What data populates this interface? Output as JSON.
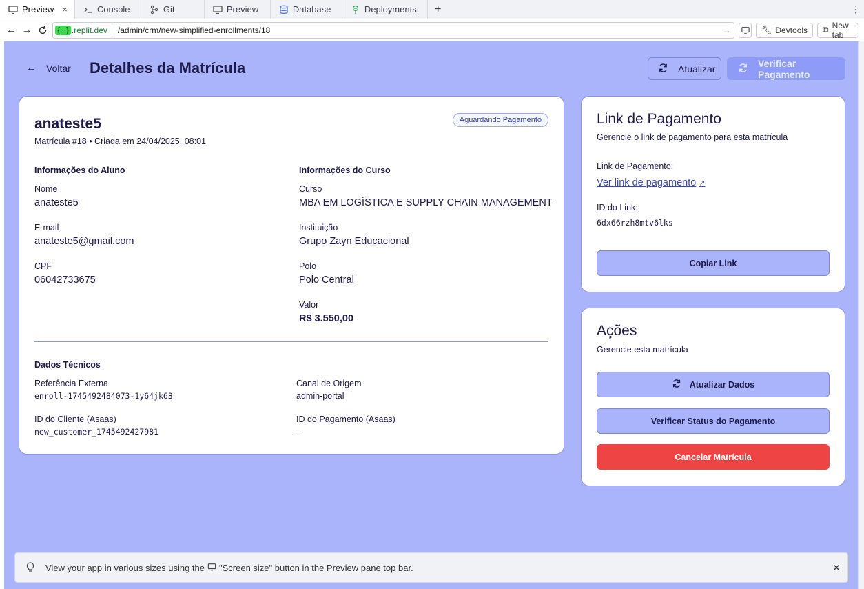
{
  "browser": {
    "tabs": [
      {
        "label": "Preview",
        "icon": "monitor-icon",
        "active": true
      },
      {
        "label": "Console",
        "icon": "terminal-icon"
      },
      {
        "label": "Git",
        "icon": "git-icon"
      },
      {
        "label": "Preview",
        "icon": "monitor-icon"
      },
      {
        "label": "Database",
        "icon": "database-icon"
      },
      {
        "label": "Deployments",
        "icon": "deploy-icon"
      }
    ],
    "close_glyph": "×",
    "add_glyph": "+",
    "host_pill": "{...}",
    "host_domain": ".replit.dev",
    "path": "/admin/crm/new-simplified-enrollments/18",
    "devtools_label": "Devtools",
    "newtab_label": "New tab"
  },
  "header": {
    "back_label": "Voltar",
    "title": "Detalhes da Matrícula",
    "refresh_label": "Atualizar",
    "verify_label": "Verificar Pagamento"
  },
  "enrollment": {
    "name": "anateste5",
    "subtitle": "Matrícula #18 • Criada em 24/04/2025, 08:01",
    "status_badge": "Aguardando Pagamento",
    "student": {
      "heading": "Informações do Aluno",
      "name_label": "Nome",
      "name_value": "anateste5",
      "email_label": "E-mail",
      "email_value": "anateste5@gmail.com",
      "cpf_label": "CPF",
      "cpf_value": "06042733675"
    },
    "course": {
      "heading": "Informações do Curso",
      "course_label": "Curso",
      "course_value": "MBA EM LOGÍSTICA E SUPPLY CHAIN MANAGEMENT",
      "institution_label": "Instituição",
      "institution_value": "Grupo Zayn Educacional",
      "hub_label": "Polo",
      "hub_value": "Polo Central",
      "price_label": "Valor",
      "price_value": "R$ 3.550,00"
    },
    "technical": {
      "heading": "Dados Técnicos",
      "ext_ref_label": "Referência Externa",
      "ext_ref_value": "enroll-1745492484073-1y64jk63",
      "origin_label": "Canal de Origem",
      "origin_value": "admin-portal",
      "client_id_label": "ID do Cliente (Asaas)",
      "client_id_value": "new_customer_1745492427981",
      "payment_id_label": "ID do Pagamento (Asaas)",
      "payment_id_value": "-"
    }
  },
  "payment_link": {
    "title": "Link de Pagamento",
    "subtitle": "Gerencie o link de pagamento para esta matrícula",
    "link_label": "Link de Pagamento:",
    "link_text": "Ver link de pagamento",
    "id_label": "ID do Link:",
    "id_value": "6dx66rzh8mtv6lks",
    "copy_label": "Copiar Link"
  },
  "actions": {
    "title": "Ações",
    "subtitle": "Gerencie esta matrícula",
    "update_label": "Atualizar Dados",
    "verify_status_label": "Verificar Status do Pagamento",
    "cancel_label": "Cancelar Matrícula"
  },
  "toast": {
    "text_before": "View your app in various sizes using the",
    "text_after": "\"Screen size\" button in the Preview pane top bar."
  },
  "colors": {
    "page_bg": "#a9b4fb",
    "primary_dark": "#1e1b4b",
    "danger": "#ef4444",
    "link": "#3a47c9"
  }
}
